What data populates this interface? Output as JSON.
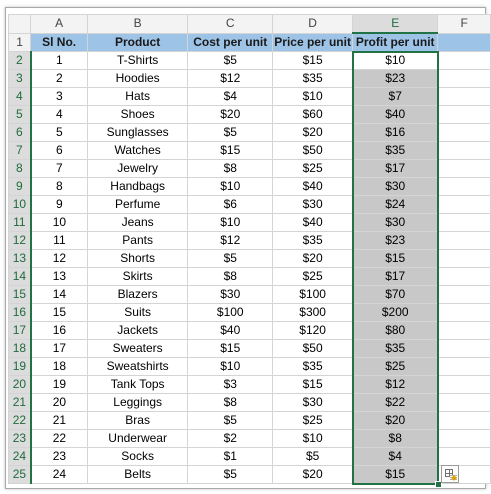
{
  "columns": [
    "A",
    "B",
    "C",
    "D",
    "E",
    "F"
  ],
  "headers": {
    "sl_no": "Sl No.",
    "product": "Product",
    "cost": "Cost per unit",
    "price": "Price per unit",
    "profit": "Profit per unit"
  },
  "rows": [
    {
      "row": "2",
      "sl": "1",
      "product": "T-Shirts",
      "cost": "$5",
      "price": "$15",
      "profit": "$10"
    },
    {
      "row": "3",
      "sl": "2",
      "product": "Hoodies",
      "cost": "$12",
      "price": "$35",
      "profit": "$23"
    },
    {
      "row": "4",
      "sl": "3",
      "product": "Hats",
      "cost": "$4",
      "price": "$10",
      "profit": "$7"
    },
    {
      "row": "5",
      "sl": "4",
      "product": "Shoes",
      "cost": "$20",
      "price": "$60",
      "profit": "$40"
    },
    {
      "row": "6",
      "sl": "5",
      "product": "Sunglasses",
      "cost": "$5",
      "price": "$20",
      "profit": "$16"
    },
    {
      "row": "7",
      "sl": "6",
      "product": "Watches",
      "cost": "$15",
      "price": "$50",
      "profit": "$35"
    },
    {
      "row": "8",
      "sl": "7",
      "product": "Jewelry",
      "cost": "$8",
      "price": "$25",
      "profit": "$17"
    },
    {
      "row": "9",
      "sl": "8",
      "product": "Handbags",
      "cost": "$10",
      "price": "$40",
      "profit": "$30"
    },
    {
      "row": "10",
      "sl": "9",
      "product": "Perfume",
      "cost": "$6",
      "price": "$30",
      "profit": "$24"
    },
    {
      "row": "11",
      "sl": "10",
      "product": "Jeans",
      "cost": "$10",
      "price": "$40",
      "profit": "$30"
    },
    {
      "row": "12",
      "sl": "11",
      "product": "Pants",
      "cost": "$12",
      "price": "$35",
      "profit": "$23"
    },
    {
      "row": "13",
      "sl": "12",
      "product": "Shorts",
      "cost": "$5",
      "price": "$20",
      "profit": "$15"
    },
    {
      "row": "14",
      "sl": "13",
      "product": "Skirts",
      "cost": "$8",
      "price": "$25",
      "profit": "$17"
    },
    {
      "row": "15",
      "sl": "14",
      "product": "Blazers",
      "cost": "$30",
      "price": "$100",
      "profit": "$70"
    },
    {
      "row": "16",
      "sl": "15",
      "product": "Suits",
      "cost": "$100",
      "price": "$300",
      "profit": "$200"
    },
    {
      "row": "17",
      "sl": "16",
      "product": "Jackets",
      "cost": "$40",
      "price": "$120",
      "profit": "$80"
    },
    {
      "row": "18",
      "sl": "17",
      "product": "Sweaters",
      "cost": "$15",
      "price": "$50",
      "profit": "$35"
    },
    {
      "row": "19",
      "sl": "18",
      "product": "Sweatshirts",
      "cost": "$10",
      "price": "$35",
      "profit": "$25"
    },
    {
      "row": "20",
      "sl": "19",
      "product": "Tank Tops",
      "cost": "$3",
      "price": "$15",
      "profit": "$12"
    },
    {
      "row": "21",
      "sl": "20",
      "product": "Leggings",
      "cost": "$8",
      "price": "$30",
      "profit": "$22"
    },
    {
      "row": "22",
      "sl": "21",
      "product": "Bras",
      "cost": "$5",
      "price": "$25",
      "profit": "$20"
    },
    {
      "row": "23",
      "sl": "22",
      "product": "Underwear",
      "cost": "$2",
      "price": "$10",
      "profit": "$8"
    },
    {
      "row": "24",
      "sl": "23",
      "product": "Socks",
      "cost": "$1",
      "price": "$5",
      "profit": "$4"
    },
    {
      "row": "25",
      "sl": "24",
      "product": "Belts",
      "cost": "$5",
      "price": "$20",
      "profit": "$15"
    }
  ],
  "header_row_number": "1",
  "colors": {
    "header_fill": "#9dc3e6",
    "selection_border": "#217346",
    "selected_fill": "#c8c8c8"
  },
  "icons": {
    "quick_analysis": "quick-analysis-icon"
  }
}
